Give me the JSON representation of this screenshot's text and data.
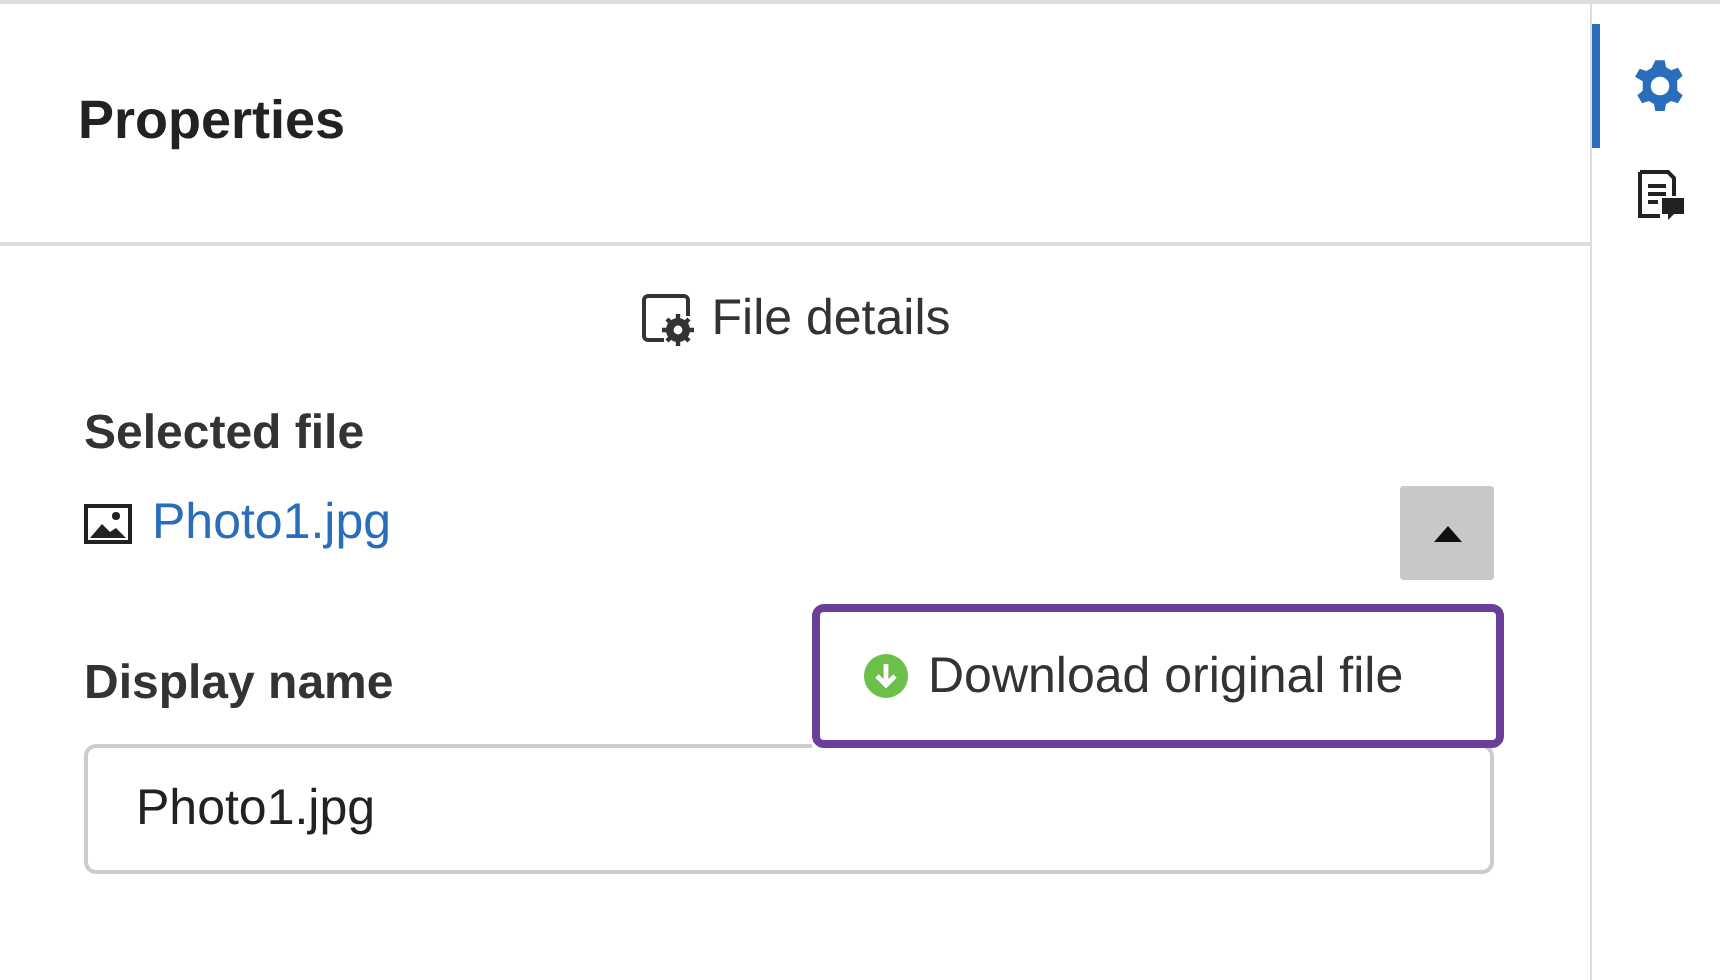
{
  "panel": {
    "title": "Properties"
  },
  "section": {
    "title": "File details"
  },
  "selected_file": {
    "label": "Selected file",
    "file_name": "Photo1.jpg",
    "menu_expanded": true
  },
  "menu": {
    "items": [
      {
        "label": "Download original file",
        "focused": true
      }
    ]
  },
  "display_name": {
    "label": "Display name",
    "value": "Photo1.jpg"
  },
  "rail": {
    "tabs": [
      {
        "kind": "settings",
        "selected": true
      },
      {
        "kind": "notes",
        "selected": false
      }
    ]
  }
}
